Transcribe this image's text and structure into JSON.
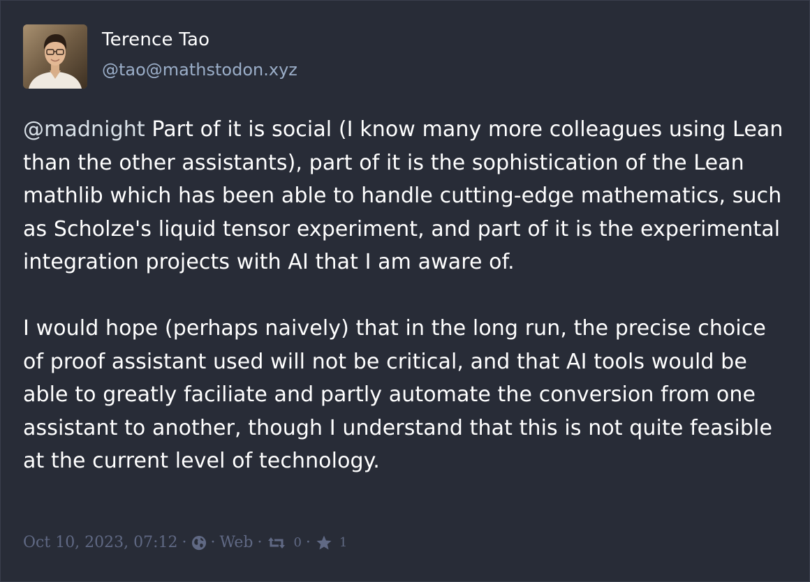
{
  "author": {
    "display_name": "Terence Tao",
    "account": "@tao@mathstodon.xyz"
  },
  "post": {
    "mention": "@madnight",
    "paragraph1": " Part of it is social (I know many more colleagues using Lean than the other assistants), part of it is the sophistication of the Lean mathlib which has been able to handle cutting-edge mathematics, such as Scholze's liquid tensor experiment, and part of it is the experimental integration projects with AI that I am aware of.",
    "paragraph2": "I would hope (perhaps naively) that in the long run, the precise choice of proof assistant used will not be critical, and that AI tools would be able to greatly faciliate and partly automate the conversion from one assistant to another, though I understand that this is not quite feasible at the current level of technology."
  },
  "meta": {
    "timestamp": "Oct 10, 2023, 07:12",
    "separator": "·",
    "visibility_icon": "globe-icon",
    "application": "Web",
    "reblog_icon": "retweet-icon",
    "reblog_count": "0",
    "favourite_icon": "star-icon",
    "favourite_count": "1"
  },
  "colors": {
    "background": "#282c37",
    "text": "#ffffff",
    "account": "#9baec8",
    "meta": "#606984"
  }
}
